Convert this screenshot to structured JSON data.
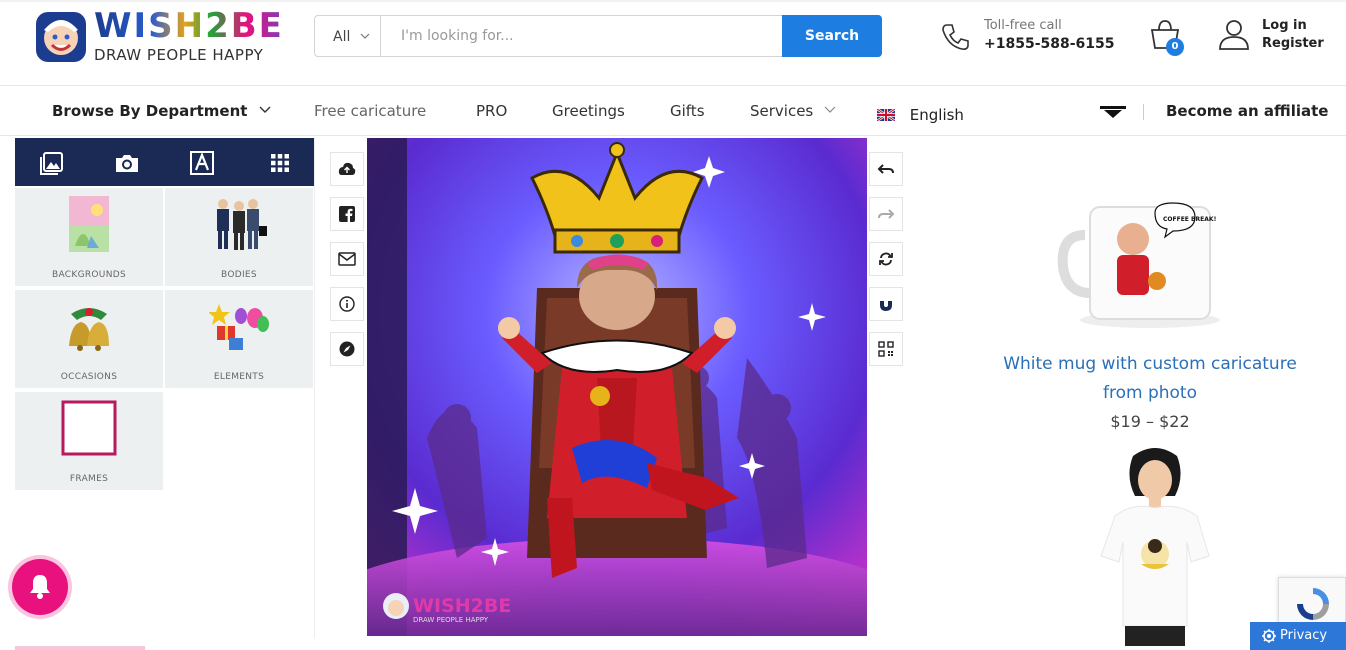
{
  "brand": {
    "logo_text": "WISH2BE",
    "tagline": "DRAW PEOPLE HAPPY"
  },
  "search": {
    "category": "All",
    "placeholder": "I'm looking for...",
    "button": "Search"
  },
  "contact": {
    "label": "Toll-free call",
    "phone": "+1855-588-6155"
  },
  "cart": {
    "count": "0"
  },
  "account": {
    "login": "Log in",
    "register": "Register"
  },
  "nav": {
    "department": "Browse By Department",
    "items": [
      "Free caricature",
      "PRO",
      "Greetings",
      "Gifts",
      "Services"
    ],
    "language": "English",
    "affiliate": "Become an affiliate"
  },
  "editor": {
    "tools": [
      "image-icon",
      "camera-icon",
      "text-icon",
      "grid-icon"
    ],
    "tiles": [
      "BACKGROUNDS",
      "BODIES",
      "OCCASIONS",
      "ELEMENTS",
      "FRAMES"
    ],
    "left_actions": [
      "cloud-upload-icon",
      "facebook-icon",
      "mail-icon",
      "info-icon",
      "compass-icon"
    ],
    "right_actions": [
      "undo-icon",
      "redo-icon",
      "refresh-icon",
      "magnet-icon",
      "qr-code-icon"
    ],
    "canvas_watermark": {
      "logo_text": "WISH2BE",
      "tagline": "DRAW PEOPLE HAPPY"
    }
  },
  "product": {
    "title": "White mug with custom caricature from photo",
    "price": "$19 – $22",
    "mug_bubble": "COFFEE BREAK!"
  },
  "privacy": "Privacy",
  "colors": {
    "accent": "#1e7de0",
    "toolbar": "#1a2a55",
    "bell": "#e8117e",
    "link": "#2a6fba"
  }
}
